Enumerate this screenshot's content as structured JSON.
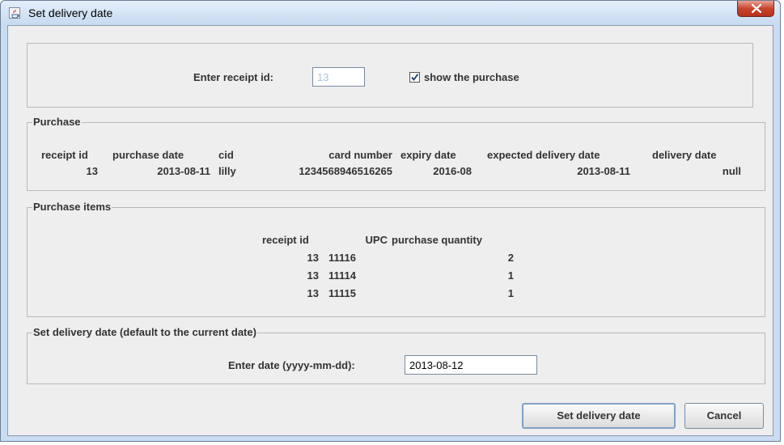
{
  "window": {
    "title": "Set delivery date",
    "icon": "java-app-icon"
  },
  "receipt": {
    "label": "Enter receipt id:",
    "value": "13",
    "show_purchase_label": "show the purchase",
    "show_purchase_checked": true
  },
  "purchase": {
    "legend": "Purchase",
    "headers": [
      "receipt id",
      "purchase date",
      "cid",
      "card number",
      "expiry date",
      "expected delivery date",
      "delivery date"
    ],
    "row": [
      "13",
      "2013-08-11",
      "lilly",
      "1234568946516265",
      "2016-08",
      "2013-08-11",
      "null"
    ]
  },
  "items": {
    "legend": "Purchase items",
    "headers": [
      "receipt id",
      "UPC",
      "purchase quantity"
    ],
    "rows": [
      [
        "13",
        "11116",
        "2"
      ],
      [
        "13",
        "11114",
        "1"
      ],
      [
        "13",
        "11115",
        "1"
      ]
    ]
  },
  "delivery": {
    "legend": "Set delivery date (default to the current date)",
    "label": "Enter date (yyyy-mm-dd):",
    "value": "2013-08-12"
  },
  "buttons": {
    "set": "Set delivery date",
    "cancel": "Cancel"
  }
}
